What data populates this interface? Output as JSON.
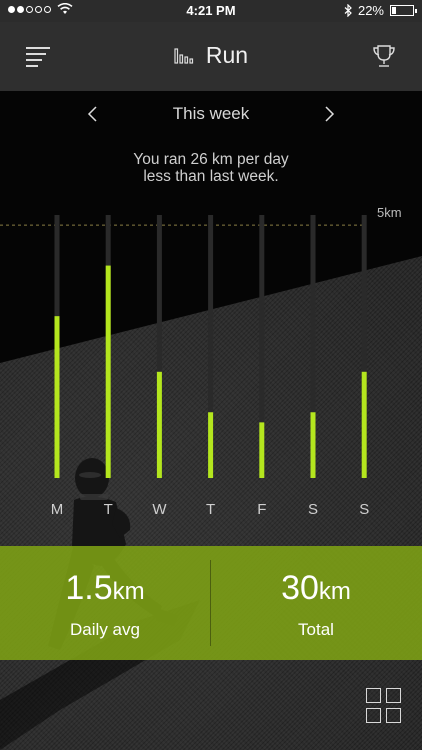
{
  "status_bar": {
    "time": "4:21 PM",
    "battery": "22%",
    "battery_level": 0.22,
    "signal_dots_filled": 2,
    "signal_dots_total": 5,
    "icons": [
      "wifi-icon",
      "bluetooth-icon",
      "battery-icon"
    ]
  },
  "nav": {
    "title": "Run",
    "left_icon": "menu-icon",
    "title_icon": "bar-chart-icon",
    "right_icon": "trophy-icon"
  },
  "week": {
    "label": "This week",
    "prev_icon": "chevron-left-icon",
    "next_icon": "chevron-right-icon"
  },
  "message": {
    "line1": "You ran 26 km per day",
    "line2": "less than last week."
  },
  "chart_data": {
    "type": "bar",
    "categories": [
      "M",
      "T",
      "W",
      "T",
      "F",
      "S",
      "S"
    ],
    "values": [
      3.2,
      4.2,
      2.1,
      1.3,
      1.1,
      1.3,
      2.1
    ],
    "ylim": [
      0,
      5.2
    ],
    "reference_line": {
      "value": 5,
      "label": "5km"
    },
    "bar_color": "#b4e61e",
    "track_color": "#2a2a2a"
  },
  "stats": {
    "daily_avg": {
      "value": "1.5",
      "unit": "km",
      "label": "Daily avg"
    },
    "total": {
      "value": "30",
      "unit": "km",
      "label": "Total"
    }
  },
  "footer": {
    "grid_icon": "grid-icon"
  },
  "colors": {
    "accent": "#b4e61e",
    "panel": "#7ea214",
    "nav": "#2f2f2f"
  }
}
